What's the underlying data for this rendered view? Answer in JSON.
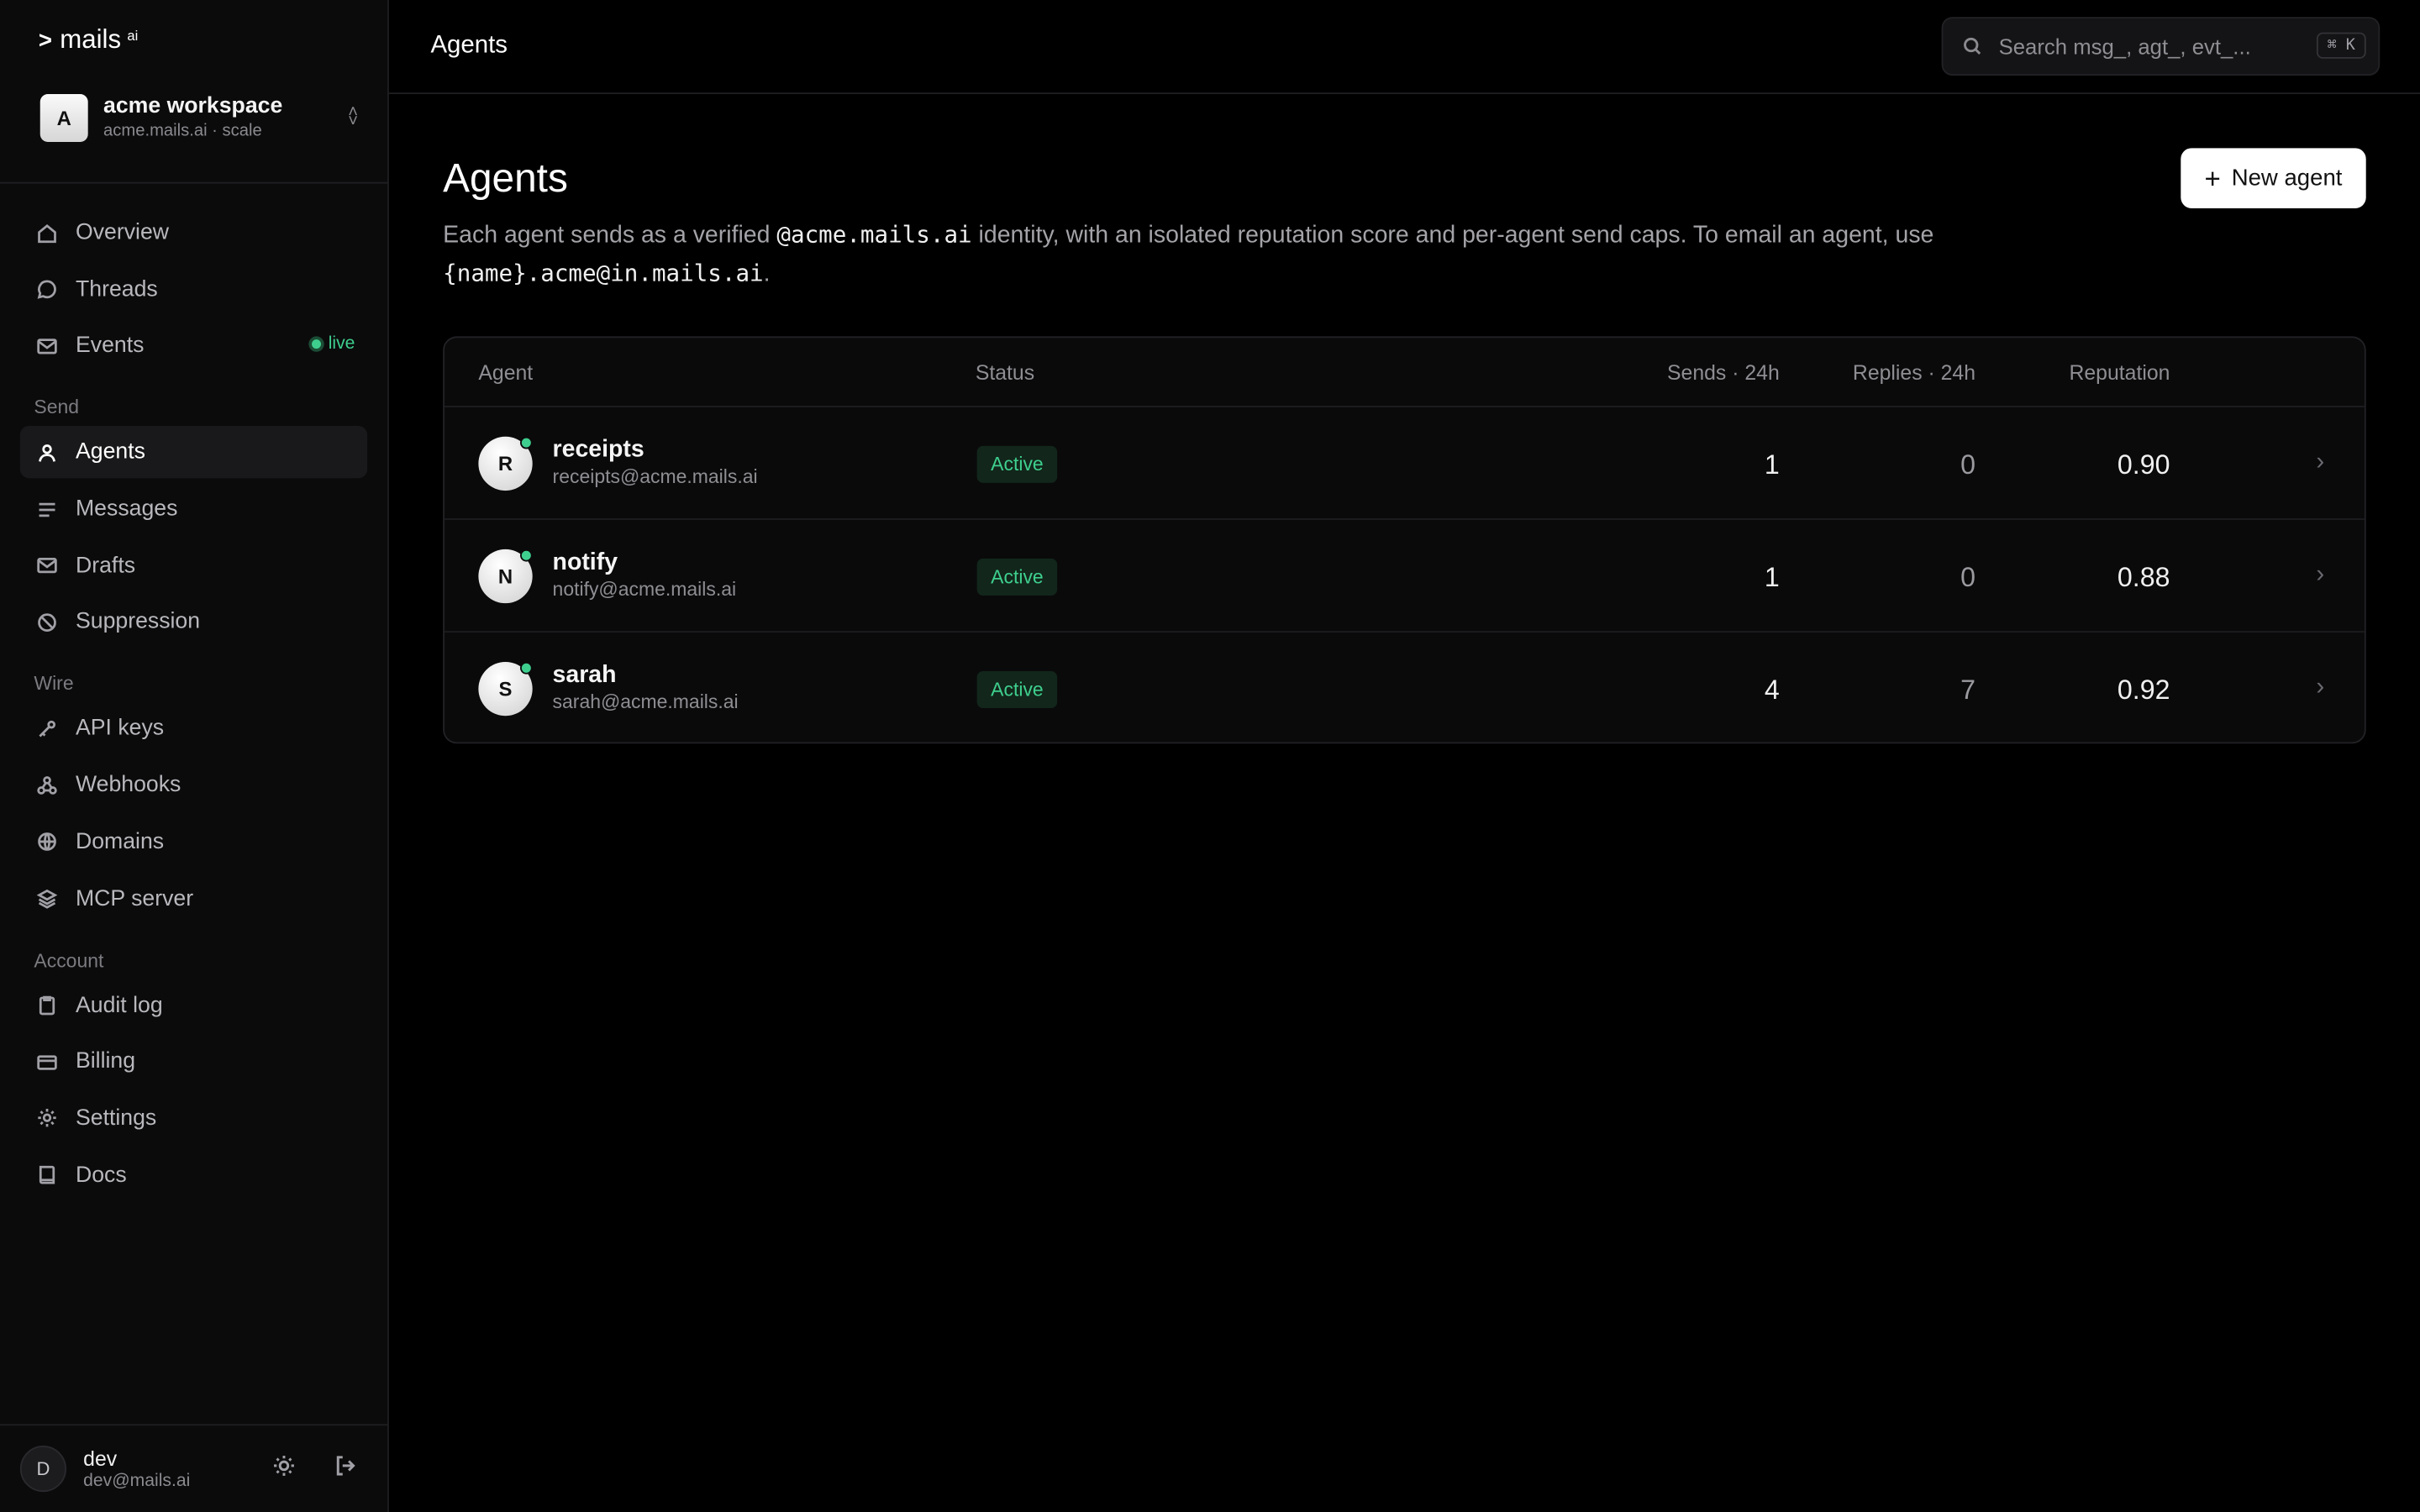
{
  "logo": {
    "text": "mails",
    "sup": "ai"
  },
  "workspace": {
    "initial": "A",
    "name": "acme workspace",
    "subtitle": "acme.mails.ai · scale"
  },
  "nav": {
    "overview": "Overview",
    "threads": "Threads",
    "events": "Events",
    "events_badge": "live",
    "section_send": "Send",
    "agents": "Agents",
    "messages": "Messages",
    "drafts": "Drafts",
    "suppression": "Suppression",
    "section_wire": "Wire",
    "api_keys": "API keys",
    "webhooks": "Webhooks",
    "domains": "Domains",
    "mcp_server": "MCP server",
    "section_account": "Account",
    "audit_log": "Audit log",
    "billing": "Billing",
    "settings": "Settings",
    "docs": "Docs"
  },
  "user": {
    "initial": "D",
    "name": "dev",
    "email": "dev@mails.ai"
  },
  "header": {
    "title": "Agents",
    "search_placeholder": "Search msg_, agt_, evt_...",
    "search_kbd": "⌘ K"
  },
  "page": {
    "title": "Agents",
    "desc_1": "Each agent sends as a verified ",
    "desc_code_1": "@acme.mails.ai",
    "desc_2": " identity, with an isolated reputation score and per-agent send caps. To email an agent, use",
    "desc_code_2": "{name}.acme@in.mails.ai",
    "desc_3": ".",
    "new_button": "New agent"
  },
  "table": {
    "columns": {
      "agent": "Agent",
      "status": "Status",
      "sends": "Sends · 24h",
      "replies": "Replies · 24h",
      "reputation": "Reputation"
    },
    "rows": [
      {
        "initial": "R",
        "name": "receipts",
        "email": "receipts@acme.mails.ai",
        "status": "Active",
        "sends": "1",
        "replies": "0",
        "reputation": "0.90"
      },
      {
        "initial": "N",
        "name": "notify",
        "email": "notify@acme.mails.ai",
        "status": "Active",
        "sends": "1",
        "replies": "0",
        "reputation": "0.88"
      },
      {
        "initial": "S",
        "name": "sarah",
        "email": "sarah@acme.mails.ai",
        "status": "Active",
        "sends": "4",
        "replies": "7",
        "reputation": "0.92"
      }
    ]
  },
  "colors": {
    "accent_green": "#3ecf8e",
    "background": "#000000",
    "sidebar": "#0b0b0c"
  }
}
